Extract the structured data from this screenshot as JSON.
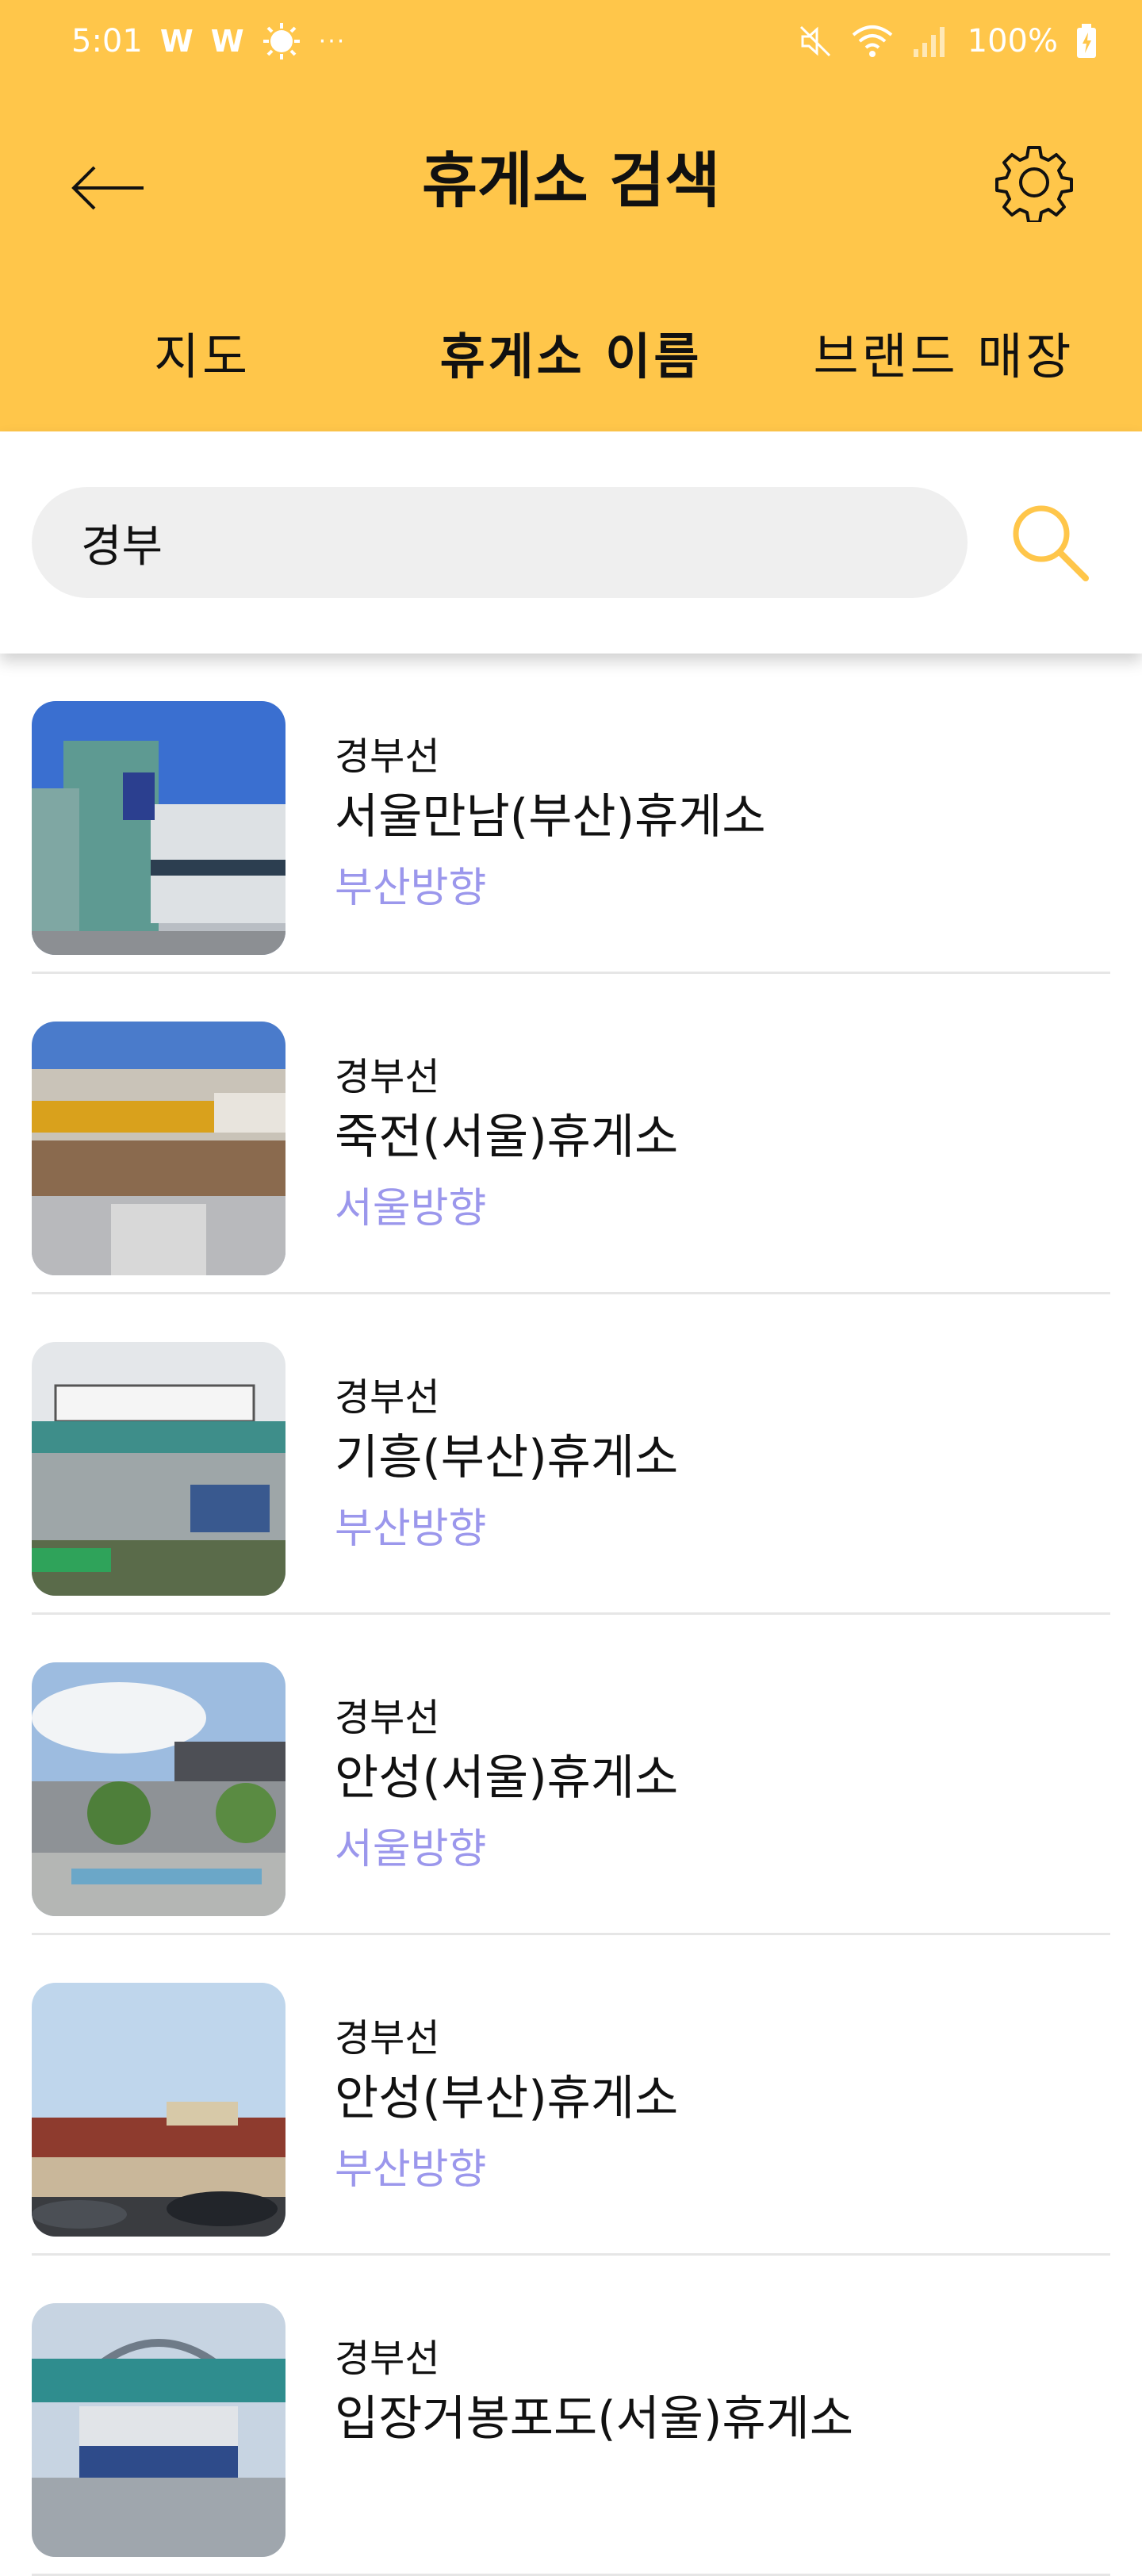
{
  "status_bar": {
    "time": "5:01",
    "notification_icons": [
      "W",
      "W"
    ],
    "battery": "100%"
  },
  "header": {
    "title": "휴게소 검색",
    "back_icon": "arrow-left-icon",
    "settings_icon": "gear-icon"
  },
  "tabs": [
    {
      "label": "지도",
      "active": false
    },
    {
      "label": "휴게소 이름",
      "active": true
    },
    {
      "label": "브랜드 매장",
      "active": false
    }
  ],
  "search": {
    "value": "경부",
    "icon": "search-icon"
  },
  "colors": {
    "accent": "#FFC64A",
    "search_icon": "#FFC64A",
    "direction_text": "#9B97EC",
    "search_bg": "#EFEFEF"
  },
  "results": [
    {
      "route": "경부선",
      "name": "서울만남(부산)휴게소",
      "direction": "부산방향"
    },
    {
      "route": "경부선",
      "name": "죽전(서울)휴게소",
      "direction": "서울방향"
    },
    {
      "route": "경부선",
      "name": "기흥(부산)휴게소",
      "direction": "부산방향"
    },
    {
      "route": "경부선",
      "name": "안성(서울)휴게소",
      "direction": "서울방향"
    },
    {
      "route": "경부선",
      "name": "안성(부산)휴게소",
      "direction": "부산방향"
    },
    {
      "route": "경부선",
      "name": "입장거봉포도(서울)휴게소",
      "direction": ""
    }
  ]
}
